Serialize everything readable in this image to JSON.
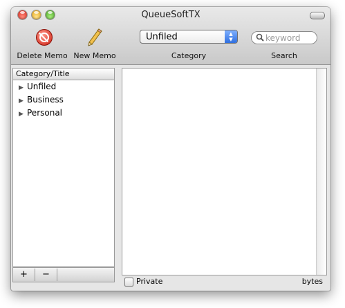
{
  "window": {
    "title": "QueueSoftTX"
  },
  "toolbar": {
    "delete_memo_label": "Delete Memo",
    "new_memo_label": "New Memo",
    "category_label": "Category",
    "search_label": "Search"
  },
  "category": {
    "selected": "Unfiled"
  },
  "search": {
    "placeholder": "keyword"
  },
  "sidebar": {
    "column_header": "Category/Title",
    "items": [
      {
        "label": "Unfiled"
      },
      {
        "label": "Business"
      },
      {
        "label": "Personal"
      }
    ],
    "add_label": "+",
    "remove_label": "−"
  },
  "footer": {
    "private_label": "Private",
    "bytes_label": "bytes"
  },
  "colors": {
    "close": "#d6241a",
    "minimize": "#e3a10f",
    "zoom": "#3f9e1a",
    "select_accent": "#2f6fe0"
  }
}
